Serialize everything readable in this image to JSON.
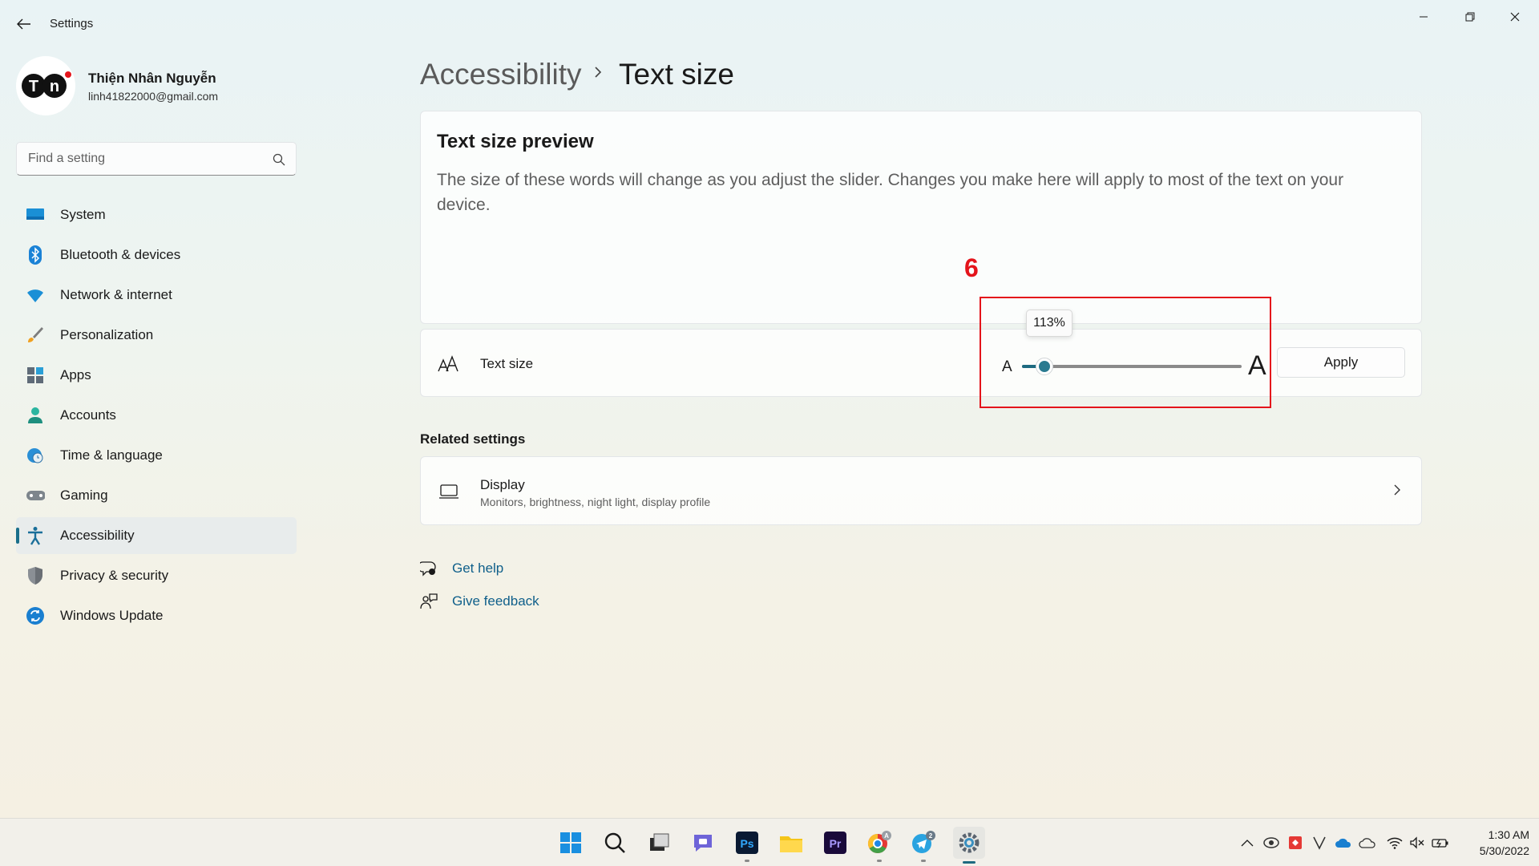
{
  "window": {
    "app_title": "Settings",
    "back_icon": "arrow-left-icon",
    "controls": [
      "minimize-icon",
      "restore-icon",
      "close-icon"
    ]
  },
  "profile": {
    "initials": "TN",
    "name": "Thiện Nhân Nguyễn",
    "email": "linh41822000@gmail.com"
  },
  "search": {
    "placeholder": "Find a setting",
    "icon": "search-icon"
  },
  "sidebar": {
    "items": [
      {
        "label": "System",
        "icon": "system-icon",
        "active": false
      },
      {
        "label": "Bluetooth & devices",
        "icon": "bluetooth-icon",
        "active": false
      },
      {
        "label": "Network & internet",
        "icon": "wifi-icon",
        "active": false
      },
      {
        "label": "Personalization",
        "icon": "brush-icon",
        "active": false
      },
      {
        "label": "Apps",
        "icon": "apps-icon",
        "active": false
      },
      {
        "label": "Accounts",
        "icon": "accounts-icon",
        "active": false
      },
      {
        "label": "Time & language",
        "icon": "globe-clock-icon",
        "active": false
      },
      {
        "label": "Gaming",
        "icon": "gamepad-icon",
        "active": false
      },
      {
        "label": "Accessibility",
        "icon": "accessibility-icon",
        "active": true
      },
      {
        "label": "Privacy & security",
        "icon": "shield-icon",
        "active": false
      },
      {
        "label": "Windows Update",
        "icon": "update-icon",
        "active": false
      }
    ]
  },
  "header": {
    "breadcrumb_parent": "Accessibility",
    "breadcrumb_current": "Text size"
  },
  "preview": {
    "title": "Text size preview",
    "text": "The size of these words will change as you adjust the slider. Changes you make here will apply to most of the text on your device."
  },
  "text_size": {
    "label": "Text size",
    "small_glyph": "A",
    "large_glyph": "A",
    "value_percent": 113,
    "value_label": "113%",
    "min_percent": 100,
    "max_percent": 225,
    "apply_label": "Apply"
  },
  "annotation": {
    "number": "6",
    "color": "#e4141b"
  },
  "related": {
    "title": "Related settings",
    "display_title": "Display",
    "display_subtitle": "Monitors, brightness, night light, display profile"
  },
  "help": {
    "get_help": "Get help",
    "give_feedback": "Give feedback"
  },
  "taskbar": {
    "apps": [
      "start-icon",
      "search-icon",
      "task-view-icon",
      "chat-icon",
      "photoshop-icon",
      "file-explorer-icon",
      "premiere-icon",
      "chrome-icon",
      "telegram-icon",
      "settings-icon"
    ],
    "photoshop_label": "Ps",
    "premiere_label": "Pr",
    "chrome_badge": "A",
    "telegram_badge": "2",
    "tray": [
      "chevron-up-icon",
      "tray-app-icon",
      "tray-app-red-icon",
      "vivaldi-icon",
      "onedrive-icon",
      "cloud-icon",
      "wifi-icon",
      "volume-muted-icon",
      "battery-icon"
    ],
    "time": "1:30 AM",
    "date": "5/30/2022"
  },
  "colors": {
    "accent": "#1d6a80",
    "link": "#0f5f8a",
    "annotation": "#e4141b"
  }
}
